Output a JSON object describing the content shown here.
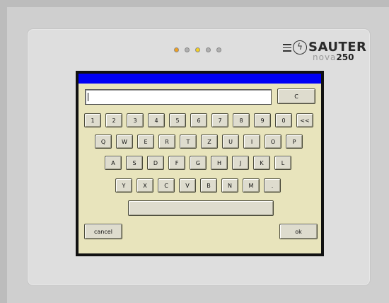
{
  "device": {
    "brand": "SAUTER",
    "product_prefix": "nova",
    "product_number": "250",
    "leds": [
      {
        "color": "#f0a020"
      },
      {
        "color": "#b0b0b0"
      },
      {
        "color": "#f5d020"
      },
      {
        "color": "#b0b0b0"
      },
      {
        "color": "#b0b0b0"
      }
    ]
  },
  "keyboard": {
    "input_value": "",
    "clear_label": "C",
    "row1": [
      "1",
      "2",
      "3",
      "4",
      "5",
      "6",
      "7",
      "8",
      "9",
      "0",
      "<<"
    ],
    "row2": [
      "Q",
      "W",
      "E",
      "R",
      "T",
      "Z",
      "U",
      "I",
      "O",
      "P"
    ],
    "row3": [
      "A",
      "S",
      "D",
      "F",
      "G",
      "H",
      "J",
      "K",
      "L"
    ],
    "row4": [
      "Y",
      "X",
      "C",
      "V",
      "B",
      "N",
      "M",
      "."
    ],
    "space_label": "",
    "cancel_label": "cancel",
    "ok_label": "ok"
  },
  "colors": {
    "titlebar": "#0000f5",
    "dialog_bg": "#e8e4bc"
  }
}
